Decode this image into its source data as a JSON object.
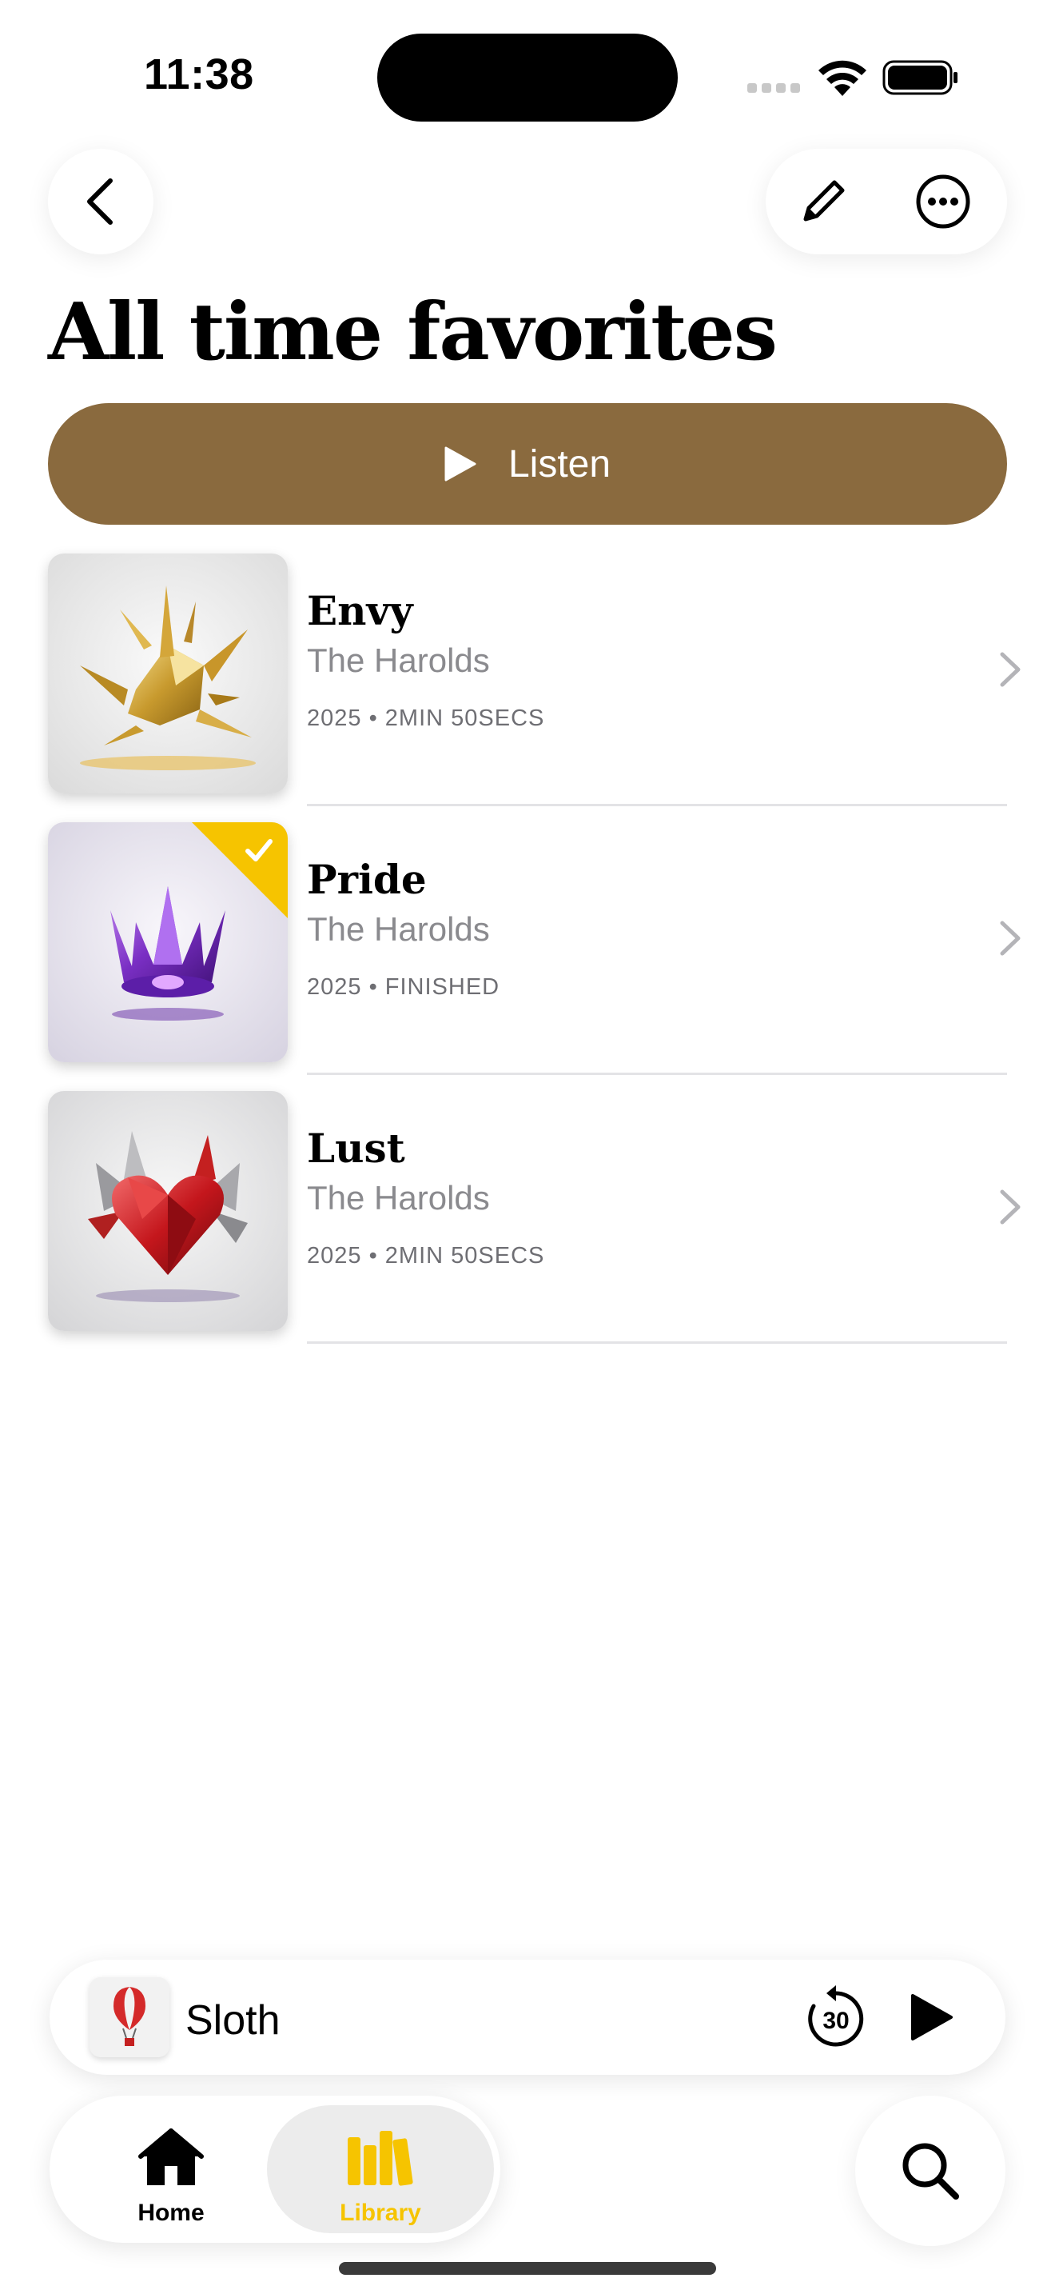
{
  "status_bar": {
    "time": "11:38"
  },
  "header": {
    "back_icon": "chevron-left-icon",
    "edit_icon": "pencil-icon",
    "more_icon": "ellipsis-circle-icon"
  },
  "page": {
    "title": "All time favorites",
    "listen_label": "Listen",
    "accent_color": "#8a6a3e"
  },
  "tracks": [
    {
      "title": "Envy",
      "artist": "The Harolds",
      "meta": "2025 • 2MIN 50SECS",
      "finished": false
    },
    {
      "title": "Pride",
      "artist": "The Harolds",
      "meta": "2025 • FINISHED",
      "finished": true
    },
    {
      "title": "Lust",
      "artist": "The Harolds",
      "meta": "2025 • 2MIN 50SECS",
      "finished": false
    }
  ],
  "mini_player": {
    "title": "Sloth",
    "skip_label": "30"
  },
  "tabs": [
    {
      "label": "Home",
      "icon": "house-icon",
      "active": false
    },
    {
      "label": "Library",
      "icon": "books-icon",
      "active": true
    }
  ],
  "search_icon": "magnifying-glass-icon",
  "colors": {
    "active_tab": "#f6c400",
    "finished_badge": "#f6c400"
  }
}
